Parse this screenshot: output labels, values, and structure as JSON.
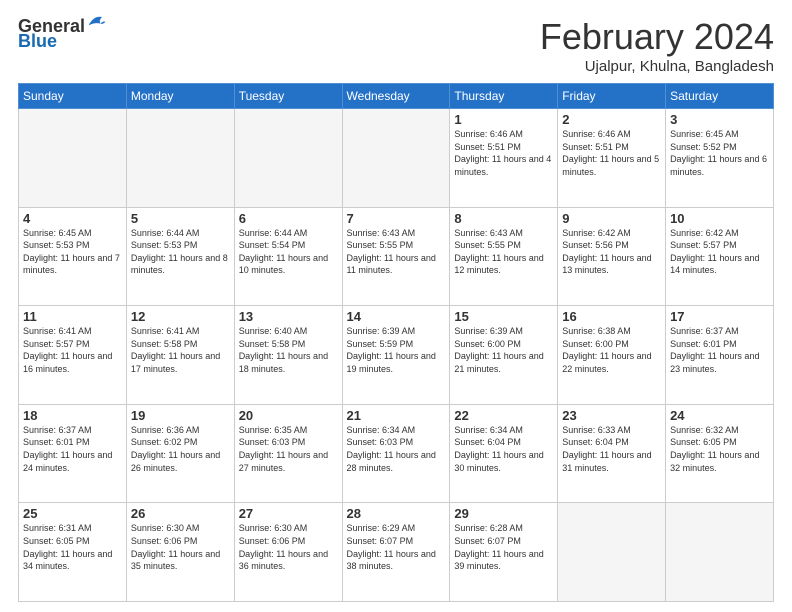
{
  "logo": {
    "general": "General",
    "blue": "Blue"
  },
  "header": {
    "month_year": "February 2024",
    "location": "Ujalpur, Khulna, Bangladesh"
  },
  "days_of_week": [
    "Sunday",
    "Monday",
    "Tuesday",
    "Wednesday",
    "Thursday",
    "Friday",
    "Saturday"
  ],
  "weeks": [
    [
      {
        "day": "",
        "info": ""
      },
      {
        "day": "",
        "info": ""
      },
      {
        "day": "",
        "info": ""
      },
      {
        "day": "",
        "info": ""
      },
      {
        "day": "1",
        "info": "Sunrise: 6:46 AM\nSunset: 5:51 PM\nDaylight: 11 hours and 4 minutes."
      },
      {
        "day": "2",
        "info": "Sunrise: 6:46 AM\nSunset: 5:51 PM\nDaylight: 11 hours and 5 minutes."
      },
      {
        "day": "3",
        "info": "Sunrise: 6:45 AM\nSunset: 5:52 PM\nDaylight: 11 hours and 6 minutes."
      }
    ],
    [
      {
        "day": "4",
        "info": "Sunrise: 6:45 AM\nSunset: 5:53 PM\nDaylight: 11 hours and 7 minutes."
      },
      {
        "day": "5",
        "info": "Sunrise: 6:44 AM\nSunset: 5:53 PM\nDaylight: 11 hours and 8 minutes."
      },
      {
        "day": "6",
        "info": "Sunrise: 6:44 AM\nSunset: 5:54 PM\nDaylight: 11 hours and 10 minutes."
      },
      {
        "day": "7",
        "info": "Sunrise: 6:43 AM\nSunset: 5:55 PM\nDaylight: 11 hours and 11 minutes."
      },
      {
        "day": "8",
        "info": "Sunrise: 6:43 AM\nSunset: 5:55 PM\nDaylight: 11 hours and 12 minutes."
      },
      {
        "day": "9",
        "info": "Sunrise: 6:42 AM\nSunset: 5:56 PM\nDaylight: 11 hours and 13 minutes."
      },
      {
        "day": "10",
        "info": "Sunrise: 6:42 AM\nSunset: 5:57 PM\nDaylight: 11 hours and 14 minutes."
      }
    ],
    [
      {
        "day": "11",
        "info": "Sunrise: 6:41 AM\nSunset: 5:57 PM\nDaylight: 11 hours and 16 minutes."
      },
      {
        "day": "12",
        "info": "Sunrise: 6:41 AM\nSunset: 5:58 PM\nDaylight: 11 hours and 17 minutes."
      },
      {
        "day": "13",
        "info": "Sunrise: 6:40 AM\nSunset: 5:58 PM\nDaylight: 11 hours and 18 minutes."
      },
      {
        "day": "14",
        "info": "Sunrise: 6:39 AM\nSunset: 5:59 PM\nDaylight: 11 hours and 19 minutes."
      },
      {
        "day": "15",
        "info": "Sunrise: 6:39 AM\nSunset: 6:00 PM\nDaylight: 11 hours and 21 minutes."
      },
      {
        "day": "16",
        "info": "Sunrise: 6:38 AM\nSunset: 6:00 PM\nDaylight: 11 hours and 22 minutes."
      },
      {
        "day": "17",
        "info": "Sunrise: 6:37 AM\nSunset: 6:01 PM\nDaylight: 11 hours and 23 minutes."
      }
    ],
    [
      {
        "day": "18",
        "info": "Sunrise: 6:37 AM\nSunset: 6:01 PM\nDaylight: 11 hours and 24 minutes."
      },
      {
        "day": "19",
        "info": "Sunrise: 6:36 AM\nSunset: 6:02 PM\nDaylight: 11 hours and 26 minutes."
      },
      {
        "day": "20",
        "info": "Sunrise: 6:35 AM\nSunset: 6:03 PM\nDaylight: 11 hours and 27 minutes."
      },
      {
        "day": "21",
        "info": "Sunrise: 6:34 AM\nSunset: 6:03 PM\nDaylight: 11 hours and 28 minutes."
      },
      {
        "day": "22",
        "info": "Sunrise: 6:34 AM\nSunset: 6:04 PM\nDaylight: 11 hours and 30 minutes."
      },
      {
        "day": "23",
        "info": "Sunrise: 6:33 AM\nSunset: 6:04 PM\nDaylight: 11 hours and 31 minutes."
      },
      {
        "day": "24",
        "info": "Sunrise: 6:32 AM\nSunset: 6:05 PM\nDaylight: 11 hours and 32 minutes."
      }
    ],
    [
      {
        "day": "25",
        "info": "Sunrise: 6:31 AM\nSunset: 6:05 PM\nDaylight: 11 hours and 34 minutes."
      },
      {
        "day": "26",
        "info": "Sunrise: 6:30 AM\nSunset: 6:06 PM\nDaylight: 11 hours and 35 minutes."
      },
      {
        "day": "27",
        "info": "Sunrise: 6:30 AM\nSunset: 6:06 PM\nDaylight: 11 hours and 36 minutes."
      },
      {
        "day": "28",
        "info": "Sunrise: 6:29 AM\nSunset: 6:07 PM\nDaylight: 11 hours and 38 minutes."
      },
      {
        "day": "29",
        "info": "Sunrise: 6:28 AM\nSunset: 6:07 PM\nDaylight: 11 hours and 39 minutes."
      },
      {
        "day": "",
        "info": ""
      },
      {
        "day": "",
        "info": ""
      }
    ]
  ]
}
